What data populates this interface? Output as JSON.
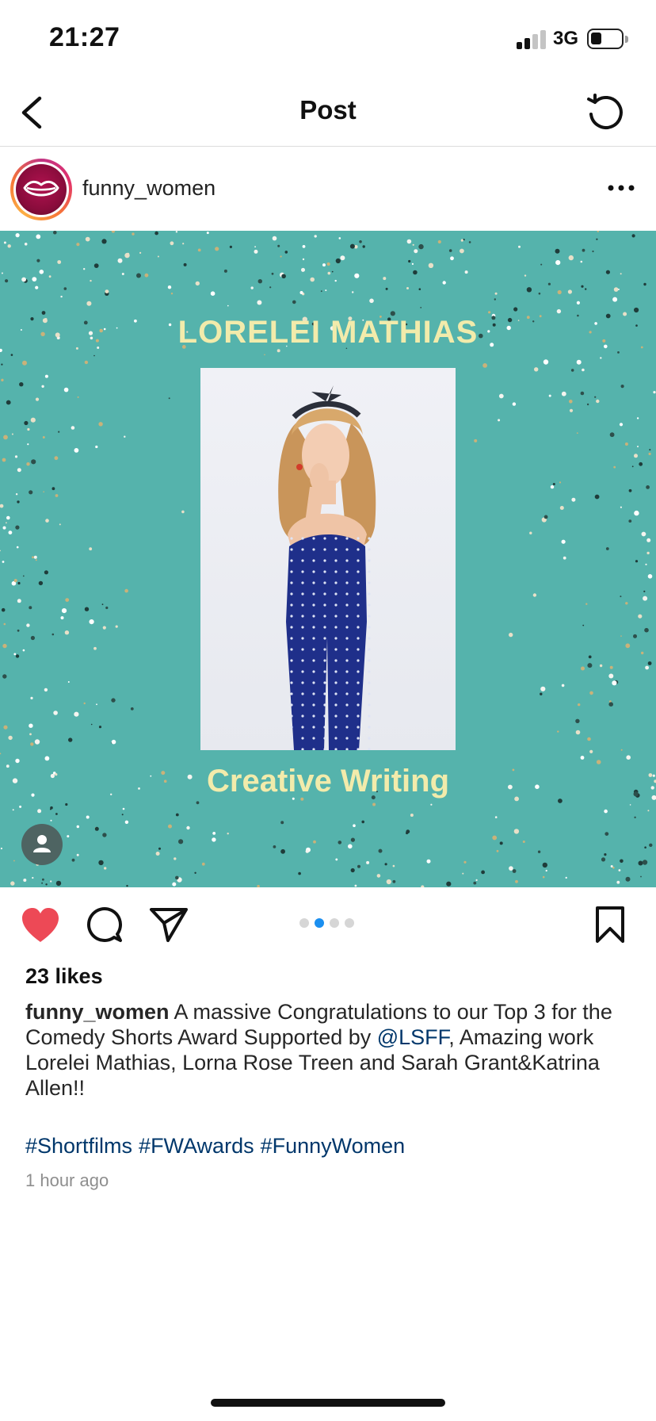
{
  "status_bar": {
    "time": "21:27",
    "network": "3G"
  },
  "header": {
    "title": "Post",
    "back_icon": "chevron-left-icon",
    "refresh_icon": "refresh-icon"
  },
  "author": {
    "username": "funny_women",
    "more_label": "•••"
  },
  "image": {
    "title": "LORELEI MATHIAS",
    "caption": "Creative Writing",
    "background_color": "#55b3ac",
    "text_color": "#f2ebab",
    "carousel_total": 4,
    "carousel_active": 2
  },
  "actions": {
    "liked": true,
    "heart_color": "#ed4956"
  },
  "likes": "23 likes",
  "caption": {
    "username": "funny_women",
    "text_before": " A massive Congratulations to our Top 3 for the Comedy Shorts Award Supported by ",
    "mention": "@LSFF",
    "text_after": ", Amazing work Lorelei Mathias, Lorna Rose Treen and Sarah Grant&Katrina Allen!!"
  },
  "hashtags": [
    "#Shortfilms",
    "#FWAwards",
    "#FunnyWomen"
  ],
  "time_ago": "1 hour ago"
}
